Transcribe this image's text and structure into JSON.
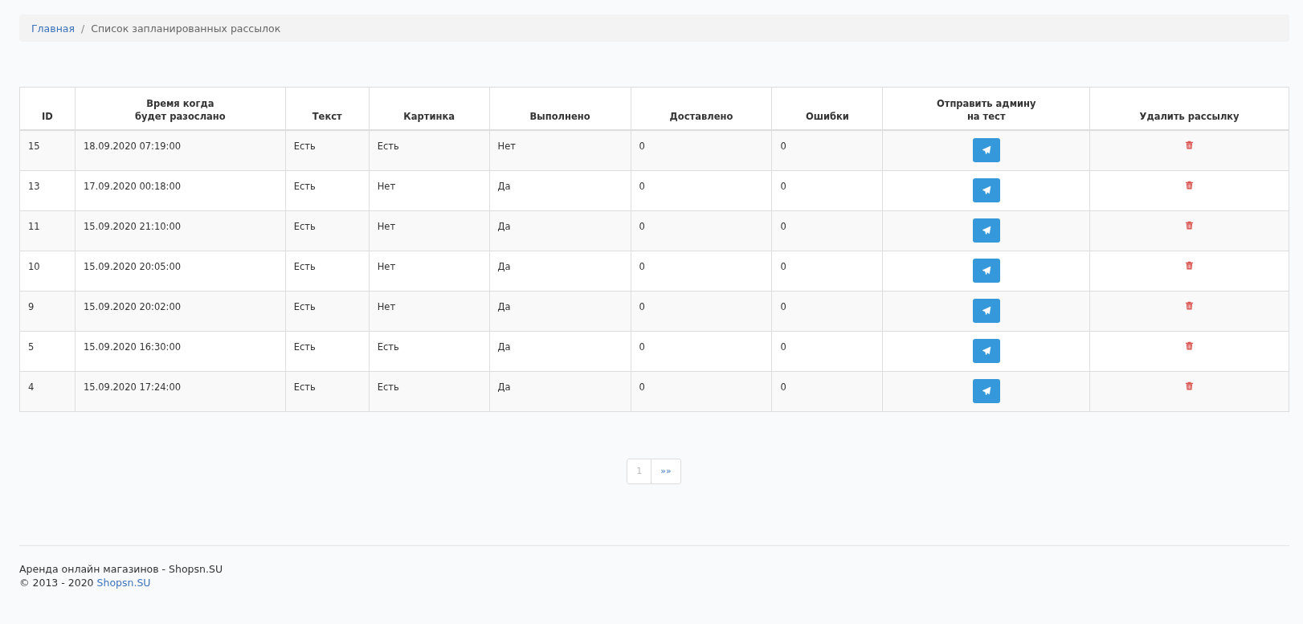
{
  "breadcrumb_separator": "/",
  "breadcrumb": [
    {
      "label": "Главная",
      "kind": "link"
    },
    {
      "label": "Список запланированных рассылок",
      "kind": "current"
    }
  ],
  "table": {
    "columns": [
      "ID",
      "Время когда\nбудет разослано",
      "Текст",
      "Картинка",
      "Выполнено",
      "Доставлено",
      "Ошибки",
      "Отправить админу\nна тест",
      "Удалить рассылку"
    ],
    "rows": [
      {
        "id": "15",
        "time": "18.09.2020 07:19:00",
        "text": "Есть",
        "image": "Есть",
        "done": "Нет",
        "delivered": "0",
        "errors": "0"
      },
      {
        "id": "13",
        "time": "17.09.2020 00:18:00",
        "text": "Есть",
        "image": "Нет",
        "done": "Да",
        "delivered": "0",
        "errors": "0"
      },
      {
        "id": "11",
        "time": "15.09.2020 21:10:00",
        "text": "Есть",
        "image": "Нет",
        "done": "Да",
        "delivered": "0",
        "errors": "0"
      },
      {
        "id": "10",
        "time": "15.09.2020 20:05:00",
        "text": "Есть",
        "image": "Нет",
        "done": "Да",
        "delivered": "0",
        "errors": "0"
      },
      {
        "id": "9",
        "time": "15.09.2020 20:02:00",
        "text": "Есть",
        "image": "Нет",
        "done": "Да",
        "delivered": "0",
        "errors": "0"
      },
      {
        "id": "5",
        "time": "15.09.2020 16:30:00",
        "text": "Есть",
        "image": "Есть",
        "done": "Да",
        "delivered": "0",
        "errors": "0"
      },
      {
        "id": "4",
        "time": "15.09.2020 17:24:00",
        "text": "Есть",
        "image": "Есть",
        "done": "Да",
        "delivered": "0",
        "errors": "0"
      }
    ]
  },
  "pagination": [
    {
      "label": "1",
      "selected": true
    },
    {
      "label": "»»",
      "selected": false
    }
  ],
  "footer": {
    "tagline": "Аренда онлайн магазинов - Shopsn.SU",
    "copyright": "© 2013 - 2020",
    "link": "Shopsn.SU"
  }
}
